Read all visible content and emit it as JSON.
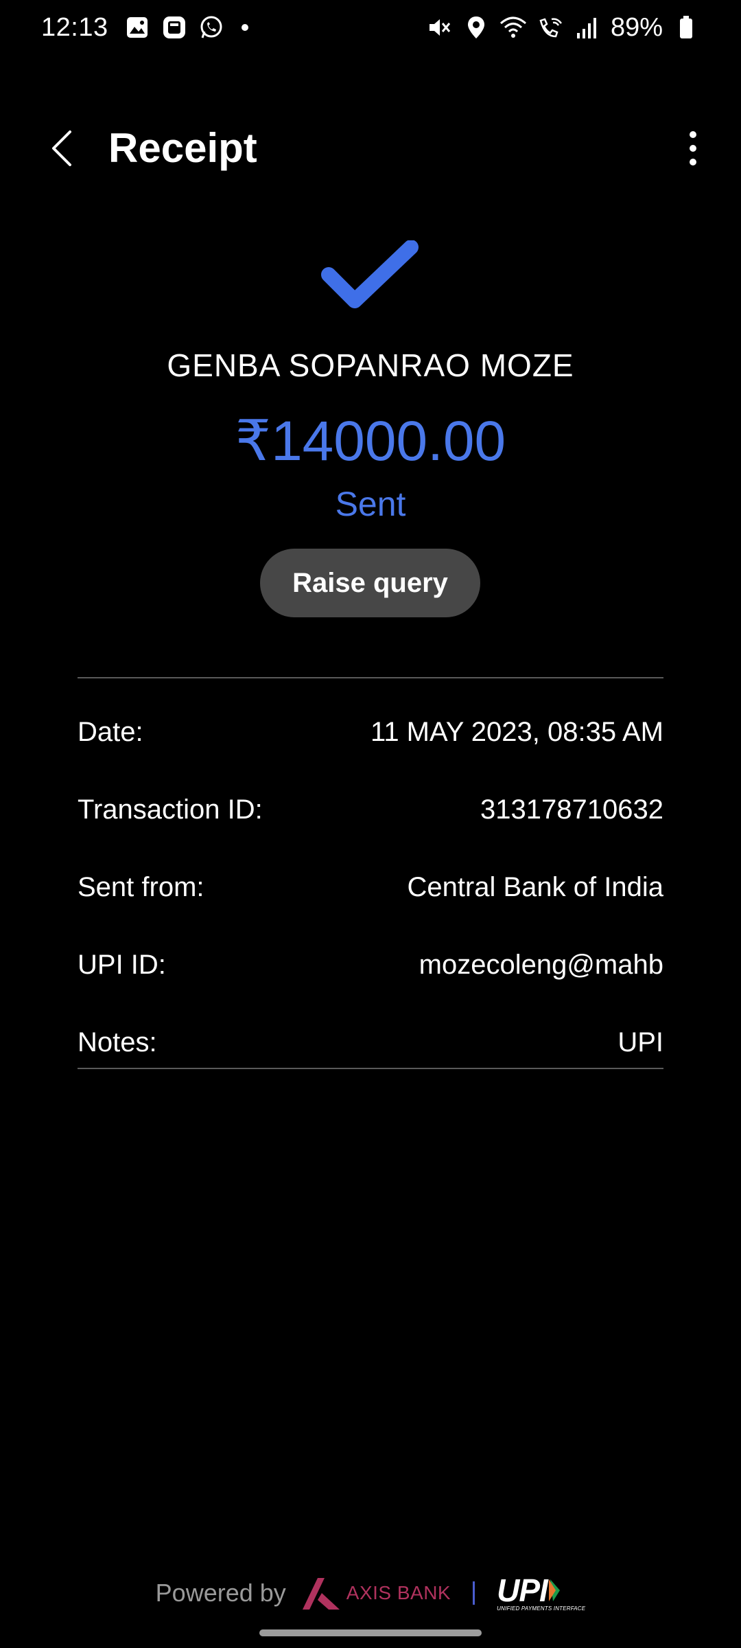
{
  "status_bar": {
    "time": "12:13",
    "battery": "89%",
    "icons_left": [
      "gallery-icon",
      "flipboard-icon",
      "whatsapp-icon",
      "dot-icon"
    ],
    "icons_right": [
      "mute-icon",
      "location-icon",
      "wifi-icon",
      "wifi-call-icon",
      "signal-icon",
      "battery-icon"
    ]
  },
  "app_bar": {
    "title": "Receipt"
  },
  "transaction": {
    "payee": "GENBA SOPANRAO MOZE",
    "amount": "₹14000.00",
    "status": "Sent",
    "raise_query_label": "Raise query"
  },
  "details": [
    {
      "label": "Date:",
      "value": "11 MAY 2023, 08:35 AM"
    },
    {
      "label": "Transaction ID:",
      "value": "313178710632"
    },
    {
      "label": "Sent from:",
      "value": "Central Bank of India"
    },
    {
      "label": "UPI ID:",
      "value": "mozecoleng@mahb"
    },
    {
      "label": "Notes:",
      "value": "UPI"
    }
  ],
  "footer": {
    "powered_by": "Powered by",
    "bank_name": "AXIS BANK",
    "upi_text": "UPI",
    "upi_subtext": "UNIFIED PAYMENTS INTERFACE"
  },
  "colors": {
    "accent": "#4a78ea",
    "background": "#000000",
    "button": "#474747",
    "axis_brand": "#b0325e"
  }
}
